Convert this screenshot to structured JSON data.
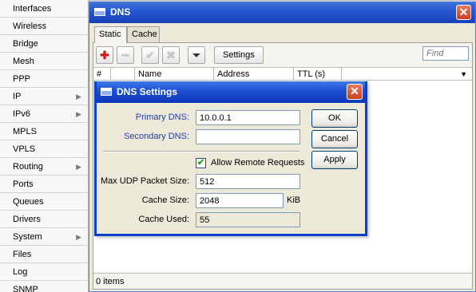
{
  "sidebar": {
    "items": [
      {
        "label": "Interfaces",
        "submenu": false
      },
      {
        "label": "Wireless",
        "submenu": false
      },
      {
        "label": "Bridge",
        "submenu": false
      },
      {
        "label": "Mesh",
        "submenu": false
      },
      {
        "label": "PPP",
        "submenu": false
      },
      {
        "label": "IP",
        "submenu": true
      },
      {
        "label": "IPv6",
        "submenu": true
      },
      {
        "label": "MPLS",
        "submenu": false
      },
      {
        "label": "VPLS",
        "submenu": false
      },
      {
        "label": "Routing",
        "submenu": true
      },
      {
        "label": "Ports",
        "submenu": false
      },
      {
        "label": "Queues",
        "submenu": false
      },
      {
        "label": "Drivers",
        "submenu": false
      },
      {
        "label": "System",
        "submenu": true
      },
      {
        "label": "Files",
        "submenu": false
      },
      {
        "label": "Log",
        "submenu": false
      },
      {
        "label": "SNMP",
        "submenu": false
      }
    ],
    "submenu_arrow": "▶"
  },
  "dns_window": {
    "title": "DNS",
    "close_glyph": "✕",
    "tabs": [
      {
        "label": "Static"
      },
      {
        "label": "Cache"
      }
    ],
    "active_tab": "Static",
    "toolbar": {
      "add_glyph": "✚",
      "remove_glyph": "━",
      "enable_glyph": "✔",
      "disable_glyph": "✖",
      "filter_glyph": "⏷",
      "settings_label": "Settings",
      "find_placeholder": "Find"
    },
    "columns": [
      "#",
      "Name",
      "Address",
      "TTL (s)"
    ],
    "sort_glyph": "▼",
    "status": "0 items"
  },
  "dns_settings": {
    "title": "DNS Settings",
    "close_glyph": "✕",
    "primary_dns_label": "Primary DNS:",
    "primary_dns_value": "10.0.0.1",
    "secondary_dns_label": "Secondary DNS:",
    "secondary_dns_value": "",
    "allow_remote_label": "Allow Remote Requests",
    "allow_remote_checked": true,
    "check_glyph": "✔",
    "max_udp_label": "Max UDP Packet Size:",
    "max_udp_value": "512",
    "cache_size_label": "Cache Size:",
    "cache_size_value": "2048",
    "cache_size_unit": "KiB",
    "cache_used_label": "Cache Used:",
    "cache_used_value": "55",
    "ok_label": "OK",
    "cancel_label": "Cancel",
    "apply_label": "Apply"
  },
  "colors": {
    "title_bar": "#2456cf",
    "label_blue": "#1f3fbf",
    "add_red": "#d11a1a"
  }
}
